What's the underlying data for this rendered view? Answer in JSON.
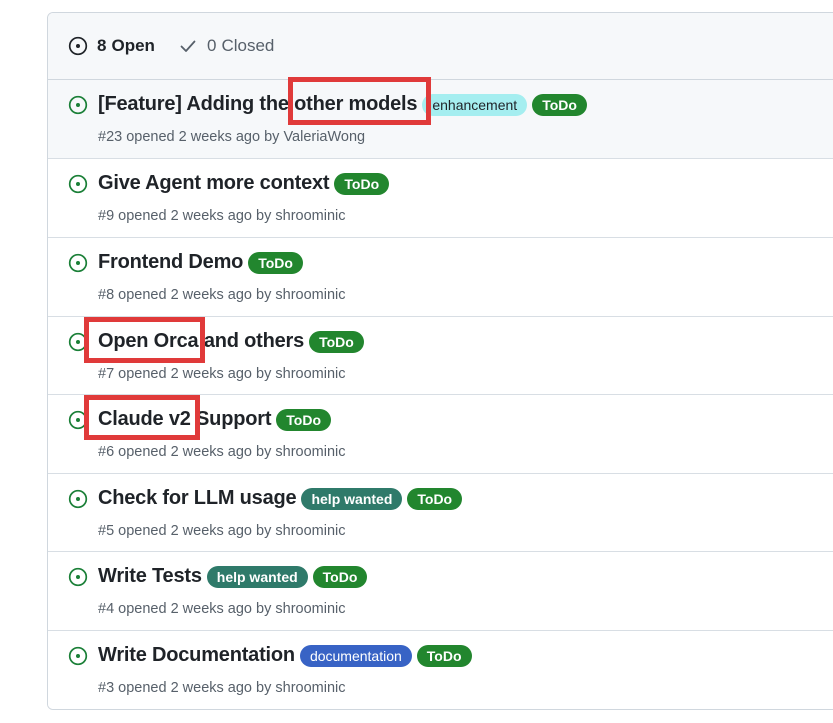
{
  "header": {
    "open_count": "8",
    "open_label": "Open",
    "closed_count": "0",
    "closed_label": "Closed"
  },
  "issues": [
    {
      "title": "[Feature] Adding the other models",
      "labels": [
        {
          "text": "enhancement",
          "kind": "enhancement",
          "color": "#a5eef0"
        },
        {
          "text": "ToDo",
          "kind": "todo",
          "color": "#22862e"
        }
      ],
      "number": "#23",
      "opened": "opened 2 weeks ago by",
      "author": "ValeriaWong"
    },
    {
      "title": "Give Agent more context",
      "labels": [
        {
          "text": "ToDo",
          "kind": "todo",
          "color": "#22862e"
        }
      ],
      "number": "#9",
      "opened": "opened 2 weeks ago by",
      "author": "shroominic"
    },
    {
      "title": "Frontend Demo",
      "labels": [
        {
          "text": "ToDo",
          "kind": "todo",
          "color": "#22862e"
        }
      ],
      "number": "#8",
      "opened": "opened 2 weeks ago by",
      "author": "shroominic"
    },
    {
      "title": "Open Orca and others",
      "labels": [
        {
          "text": "ToDo",
          "kind": "todo",
          "color": "#22862e"
        }
      ],
      "number": "#7",
      "opened": "opened 2 weeks ago by",
      "author": "shroominic"
    },
    {
      "title": "Claude v2 Support",
      "labels": [
        {
          "text": "ToDo",
          "kind": "todo",
          "color": "#22862e"
        }
      ],
      "number": "#6",
      "opened": "opened 2 weeks ago by",
      "author": "shroominic"
    },
    {
      "title": "Check for LLM usage",
      "labels": [
        {
          "text": "help wanted",
          "kind": "help",
          "color": "#2f7a6a"
        },
        {
          "text": "ToDo",
          "kind": "todo",
          "color": "#22862e"
        }
      ],
      "number": "#5",
      "opened": "opened 2 weeks ago by",
      "author": "shroominic"
    },
    {
      "title": "Write Tests",
      "labels": [
        {
          "text": "help wanted",
          "kind": "help",
          "color": "#2f7a6a"
        },
        {
          "text": "ToDo",
          "kind": "todo",
          "color": "#22862e"
        }
      ],
      "number": "#4",
      "opened": "opened 2 weeks ago by",
      "author": "shroominic"
    },
    {
      "title": "Write Documentation",
      "labels": [
        {
          "text": "documentation",
          "kind": "documentation",
          "color": "#3863c5"
        },
        {
          "text": "ToDo",
          "kind": "todo",
          "color": "#22862e"
        }
      ],
      "number": "#3",
      "opened": "opened 2 weeks ago by",
      "author": "shroominic"
    }
  ],
  "colors": {
    "open_icon": "#1a7f37",
    "highlight": "#e03a3a"
  },
  "icons": {
    "open_filter": "issue-opened-icon",
    "closed_filter": "check-icon",
    "row": "issue-opened-icon"
  }
}
